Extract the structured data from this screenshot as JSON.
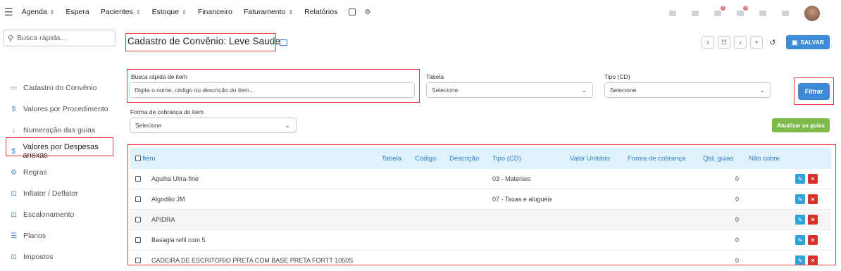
{
  "topbar": {
    "nav": [
      {
        "label": "Agenda",
        "has_chevron": true
      },
      {
        "label": "Espera",
        "has_chevron": false
      },
      {
        "label": "Pacientes",
        "has_chevron": true
      },
      {
        "label": "Estoque",
        "has_chevron": true
      },
      {
        "label": "Financeiro",
        "has_chevron": false
      },
      {
        "label": "Faturamento",
        "has_chevron": true
      },
      {
        "label": "Relatórios",
        "has_chevron": false
      }
    ],
    "badges": [
      "9",
      "3"
    ]
  },
  "search": {
    "placeholder": "Busca rápida..."
  },
  "sidebar": {
    "items": [
      {
        "label": "Cadastro do Convênio",
        "icon": "id-card-icon",
        "glyph": "▭"
      },
      {
        "label": "Valores por Procedimento",
        "icon": "dollar-icon",
        "glyph": "$"
      },
      {
        "label": "Numeração das guias",
        "icon": "sort-numeric-icon",
        "glyph": "↓"
      },
      {
        "label": "Valores por Despesas anexas",
        "icon": "dollar-icon",
        "glyph": "$",
        "active": true
      },
      {
        "label": "Regras",
        "icon": "gears-icon",
        "glyph": "⚙"
      },
      {
        "label": "Inflator / Deflator",
        "icon": "exchange-icon",
        "glyph": "⊡"
      },
      {
        "label": "Escalonamento",
        "icon": "exchange-icon",
        "glyph": "⊡"
      },
      {
        "label": "Planos",
        "icon": "list-icon",
        "glyph": "☰"
      },
      {
        "label": "Impostos",
        "icon": "exchange-icon",
        "glyph": "⊡"
      }
    ]
  },
  "page": {
    "title": "Cadastro de Convênio: Leve Saude",
    "save_label": "SALVAR"
  },
  "filters": {
    "busca_label": "Busca rápida de item",
    "busca_placeholder": "Digite o nome, código ou descrição do item...",
    "tabela_label": "Tabela",
    "tabela_value": "Selecione",
    "tipo_label": "Tipo (CD)",
    "tipo_value": "Selecione",
    "forma_label": "Forma de cobrança do item",
    "forma_value": "Selecione",
    "filtrar_label": "Filtrar",
    "atualizar_label": "Atualizar as guias"
  },
  "table": {
    "headers": {
      "item": "Item",
      "tabela": "Tabela",
      "codigo": "Código",
      "descricao": "Descrição",
      "tipo": "Tipo (CD)",
      "valor": "Valor Unitário",
      "forma": "Forma de cobrança",
      "qtd": "Qtd. guias",
      "naocobre": "Não cobre"
    },
    "rows": [
      {
        "item": "Agulha Ultra-fine",
        "tipo": "03 - Materiais",
        "qtd": "0"
      },
      {
        "item": "Algodão JM",
        "tipo": "07 - Taxas e aluguéis",
        "qtd": "0"
      },
      {
        "item": "APIDRA",
        "tipo": "",
        "qtd": "0"
      },
      {
        "item": "Basagla refil com 5",
        "tipo": "",
        "qtd": "0"
      },
      {
        "item": "CADEIRA DE ESCRITORIO PRETA COM BASE PRETA FORTT 1050S",
        "tipo": "",
        "qtd": "0"
      }
    ]
  },
  "colors": {
    "accent": "#3d8ad6",
    "success": "#7cbb4b",
    "danger": "#d9302b",
    "info": "#2ba6d9",
    "highlight": "#e03e3e"
  }
}
